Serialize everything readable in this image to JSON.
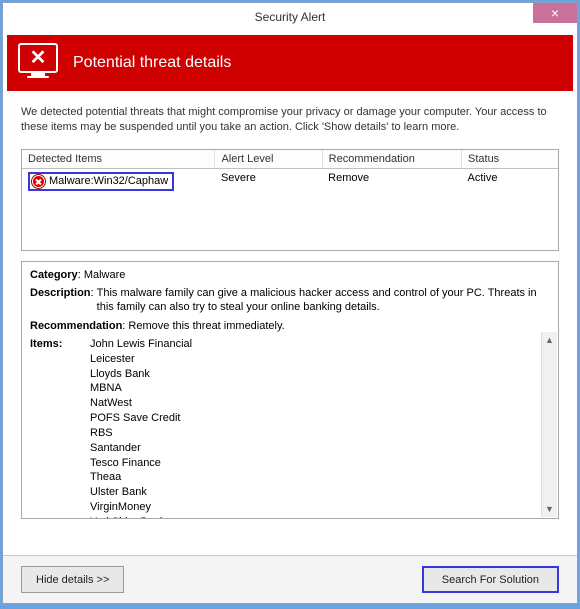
{
  "window": {
    "title": "Security Alert",
    "banner_title": "Potential threat details",
    "description": "We detected potential threats that might compromise your privacy or damage your computer. Your access to these items may be suspended until you take an action. Click 'Show details' to learn more."
  },
  "table": {
    "headers": {
      "detected": "Detected Items",
      "level": "Alert Level",
      "recommendation": "Recommendation",
      "status": "Status"
    },
    "row": {
      "name": "Malware:Win32/Caphaw",
      "level": "Severe",
      "recommendation": "Remove",
      "status": "Active"
    }
  },
  "details": {
    "category_label": "Category",
    "category_value": "Malware",
    "description_label": "Description",
    "description_value": "This malware family can give a malicious hacker access and control of your PC. Threats in this family can also try to steal your online banking details.",
    "recommendation_label": "Recommendation",
    "recommendation_value": "Remove this threat immediately.",
    "items_label": "Items:",
    "items": [
      "John Lewis Financial",
      "Leicester",
      "Lloyds Bank",
      "MBNA",
      "NatWest",
      "POFS Save Credit",
      "RBS",
      "Santander",
      "Tesco Finance",
      "Theaa",
      "Ulster Bank",
      "VirginMoney",
      "YorkShire Bank"
    ]
  },
  "footer": {
    "hide_label": "Hide details >>",
    "search_label": "Search For Solution"
  }
}
